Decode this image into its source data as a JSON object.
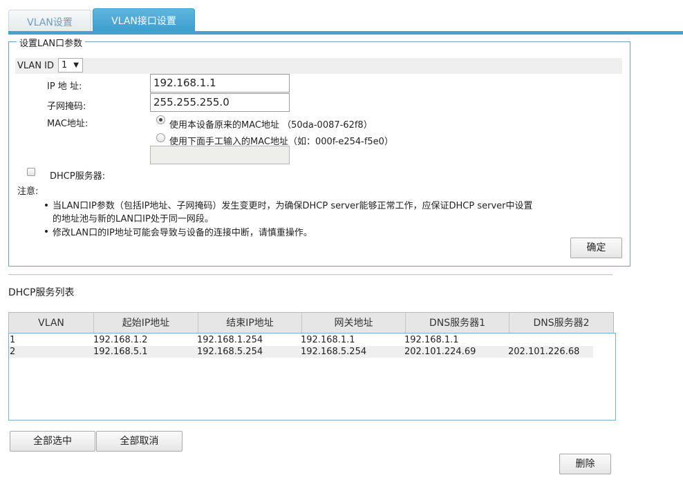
{
  "tabs": [
    {
      "label": "VLAN设置",
      "active": false
    },
    {
      "label": "VLAN接口设置",
      "active": true
    }
  ],
  "lan_section": {
    "legend": "设置LAN口参数",
    "vlan_id_label": "VLAN ID",
    "vlan_id_value": "1",
    "ip_label": "IP 地 址:",
    "ip_value": "192.168.1.1",
    "mask_label": "子网掩码:",
    "mask_value": "255.255.255.0",
    "mac_label": "MAC地址:",
    "mac_option_original": "使用本设备原来的MAC地址 （50da-0087-62f8）",
    "mac_option_manual": "使用下面手工输入的MAC地址（如：000f-e254-f5e0）",
    "mac_manual_value": "",
    "dhcp_label": "DHCP服务器:",
    "dhcp_checked": false,
    "note_title": "注意:",
    "notes": [
      "当LAN口IP参数（包括IP地址、子网掩码）发生变更时，为确保DHCP server能够正常工作，应保证DHCP server中设置",
      "的地址池与新的LAN口IP处于同一网段。",
      "修改LAN口的IP地址可能会导致与设备的连接中断，请慎重操作。"
    ],
    "confirm_button": "确定"
  },
  "dhcp_list": {
    "title": "DHCP服务列表",
    "columns": [
      "VLAN",
      "起始IP地址",
      "结束IP地址",
      "网关地址",
      "DNS服务器1",
      "DNS服务器2"
    ],
    "rows": [
      [
        "1",
        "192.168.1.2",
        "192.168.1.254",
        "192.168.1.1",
        "192.168.1.1",
        ""
      ],
      [
        "2",
        "192.168.5.1",
        "192.168.5.254",
        "192.168.5.254",
        "202.101.224.69",
        "202.101.226.68"
      ]
    ],
    "select_all_button": "全部选中",
    "deselect_all_button": "全部取消",
    "delete_button": "删除"
  }
}
